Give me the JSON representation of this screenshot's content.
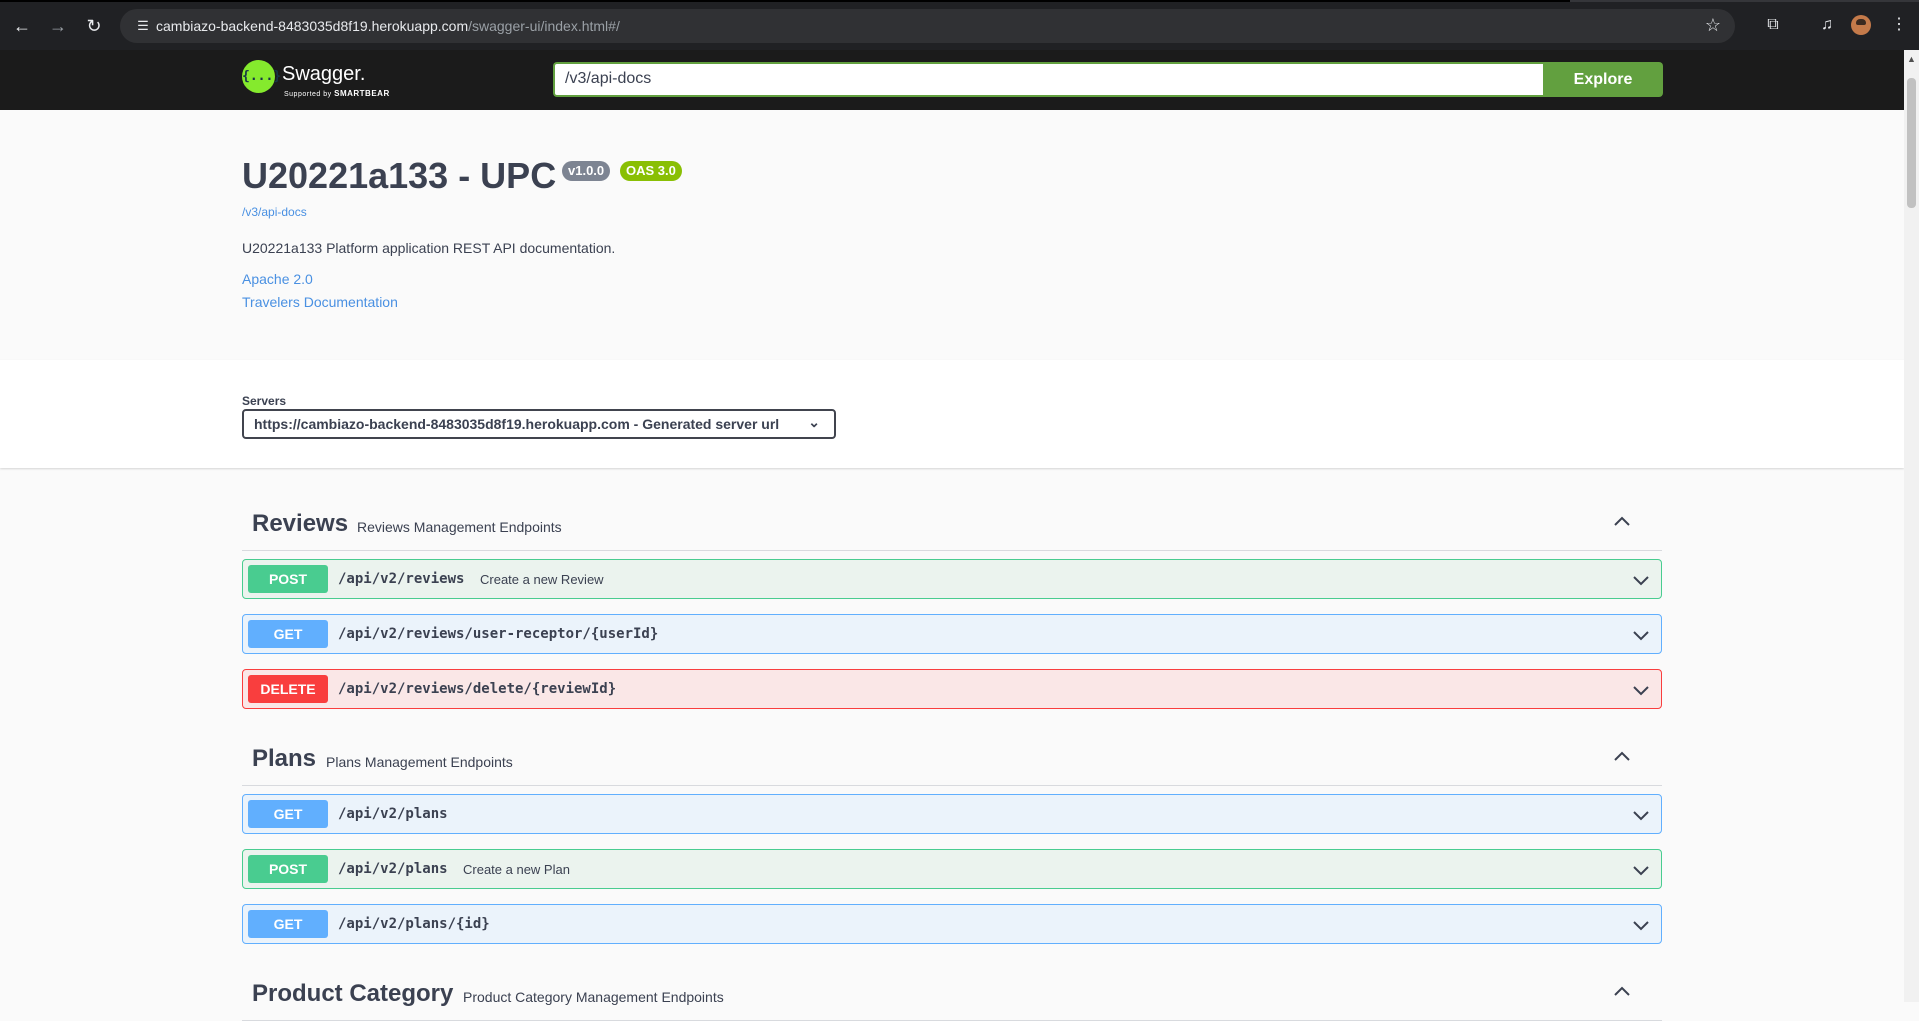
{
  "browser": {
    "url_host": "cambiazo-backend-8483035d8f19.herokuapp.com",
    "url_path": "/swagger-ui/index.html#/"
  },
  "topbar": {
    "logo_name": "Swagger.",
    "logo_sub_prefix": "Supported by",
    "logo_sub_brand": "SMARTBEAR",
    "spec_url": "/v3/api-docs",
    "explore_label": "Explore"
  },
  "info": {
    "title": "U20221a133 - UPC",
    "version_badge": "v1.0.0",
    "oas_badge": "OAS 3.0",
    "spec_link": "/v3/api-docs",
    "description": "U20221a133 Platform application REST API documentation.",
    "license": "Apache 2.0",
    "external_docs": "Travelers Documentation"
  },
  "servers": {
    "label": "Servers",
    "selected": "https://cambiazo-backend-8483035d8f19.herokuapp.com - Generated server url"
  },
  "tags": [
    {
      "name": "Reviews",
      "description": "Reviews Management Endpoints",
      "operations": [
        {
          "method": "POST",
          "path": "/api/v2/reviews",
          "summary": "Create a new Review"
        },
        {
          "method": "GET",
          "path": "/api/v2/reviews/user-receptor/{userId}",
          "summary": ""
        },
        {
          "method": "DELETE",
          "path": "/api/v2/reviews/delete/{reviewId}",
          "summary": ""
        }
      ]
    },
    {
      "name": "Plans",
      "description": "Plans Management Endpoints",
      "operations": [
        {
          "method": "GET",
          "path": "/api/v2/plans",
          "summary": ""
        },
        {
          "method": "POST",
          "path": "/api/v2/plans",
          "summary": "Create a new Plan"
        },
        {
          "method": "GET",
          "path": "/api/v2/plans/{id}",
          "summary": ""
        }
      ]
    },
    {
      "name": "Product Category",
      "description": "Product Category Management Endpoints",
      "operations": []
    }
  ],
  "colors": {
    "post": "#49cc90",
    "get": "#61affe",
    "delete": "#f93e3e",
    "accent": "#62a03f"
  }
}
